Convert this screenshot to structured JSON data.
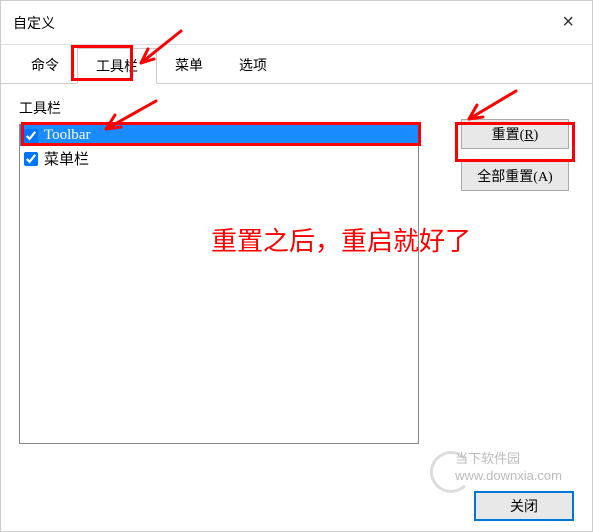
{
  "window": {
    "title": "自定义",
    "close_glyph": "×"
  },
  "tabs": {
    "items": [
      {
        "label": "命令"
      },
      {
        "label": "工具栏"
      },
      {
        "label": "菜单"
      },
      {
        "label": "选项"
      }
    ]
  },
  "content": {
    "section_label": "工具栏",
    "list": [
      {
        "label": "Toolbar",
        "checked": true,
        "selected": true
      },
      {
        "label": "菜单栏",
        "checked": true,
        "selected": false
      }
    ]
  },
  "buttons": {
    "reset": "重置(R)",
    "reset_all": "全部重置(A)",
    "close": "关闭"
  },
  "annotation": {
    "note": "重置之后，重启就好了"
  },
  "watermark": {
    "line1": "当下软件园",
    "line2": "www.downxia.com"
  }
}
